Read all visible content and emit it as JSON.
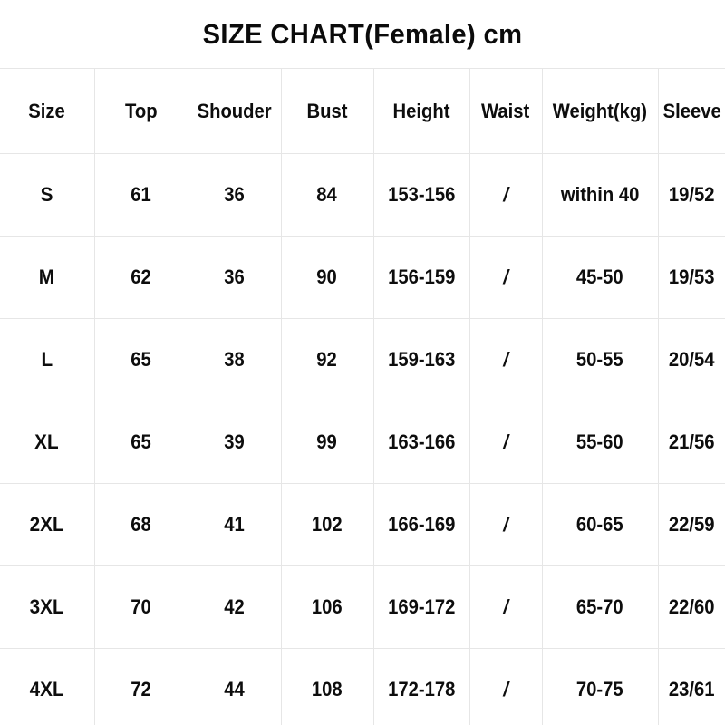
{
  "title": "SIZE CHART(Female) cm",
  "unit": "cm",
  "colors": {
    "background": "#ffffff",
    "text": "#0d0d0d",
    "gridline": "#e6e6e6"
  },
  "table": {
    "headers": [
      "Size",
      "Top",
      "Shouder",
      "Bust",
      "Height",
      "Waist",
      "Weight(kg)",
      "Sleeve"
    ],
    "rows": [
      {
        "size": "S",
        "top": "61",
        "shouder": "36",
        "bust": "84",
        "height": "153-156",
        "waist": "/",
        "weight": "within 40",
        "sleeve": "19/52"
      },
      {
        "size": "M",
        "top": "62",
        "shouder": "36",
        "bust": "90",
        "height": "156-159",
        "waist": "/",
        "weight": "45-50",
        "sleeve": "19/53"
      },
      {
        "size": "L",
        "top": "65",
        "shouder": "38",
        "bust": "92",
        "height": "159-163",
        "waist": "/",
        "weight": "50-55",
        "sleeve": "20/54"
      },
      {
        "size": "XL",
        "top": "65",
        "shouder": "39",
        "bust": "99",
        "height": "163-166",
        "waist": "/",
        "weight": "55-60",
        "sleeve": "21/56"
      },
      {
        "size": "2XL",
        "top": "68",
        "shouder": "41",
        "bust": "102",
        "height": "166-169",
        "waist": "/",
        "weight": "60-65",
        "sleeve": "22/59"
      },
      {
        "size": "3XL",
        "top": "70",
        "shouder": "42",
        "bust": "106",
        "height": "169-172",
        "waist": "/",
        "weight": "65-70",
        "sleeve": "22/60"
      },
      {
        "size": "4XL",
        "top": "72",
        "shouder": "44",
        "bust": "108",
        "height": "172-178",
        "waist": "/",
        "weight": "70-75",
        "sleeve": "23/61"
      }
    ]
  },
  "chart_data": {
    "type": "table",
    "title": "SIZE CHART(Female) cm",
    "columns": [
      "Size",
      "Top",
      "Shouder",
      "Bust",
      "Height",
      "Waist",
      "Weight(kg)",
      "Sleeve"
    ],
    "rows": [
      [
        "S",
        "61",
        "36",
        "84",
        "153-156",
        "/",
        "within 40",
        "19/52"
      ],
      [
        "M",
        "62",
        "36",
        "90",
        "156-159",
        "/",
        "45-50",
        "19/53"
      ],
      [
        "L",
        "65",
        "38",
        "92",
        "159-163",
        "/",
        "50-55",
        "20/54"
      ],
      [
        "XL",
        "65",
        "39",
        "99",
        "163-166",
        "/",
        "55-60",
        "21/56"
      ],
      [
        "2XL",
        "68",
        "41",
        "102",
        "166-169",
        "/",
        "60-65",
        "22/59"
      ],
      [
        "3XL",
        "70",
        "42",
        "106",
        "169-172",
        "/",
        "65-70",
        "22/60"
      ],
      [
        "4XL",
        "72",
        "44",
        "108",
        "172-178",
        "/",
        "70-75",
        "23/61"
      ]
    ]
  }
}
